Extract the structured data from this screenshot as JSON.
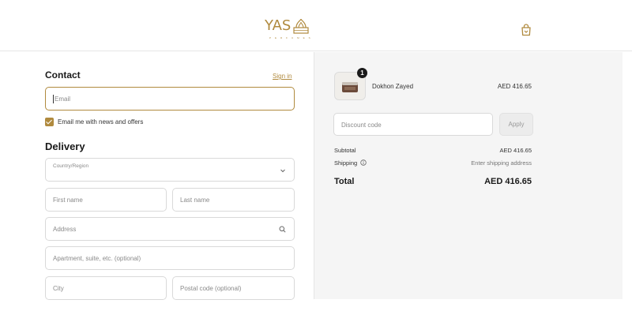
{
  "brand": {
    "logo_text": "YAS",
    "logo_sub": "PERFUMES",
    "accent": "#b08a3e"
  },
  "header": {
    "cart_icon": "shopping-bag-icon"
  },
  "contact": {
    "title": "Contact",
    "signin": "Sign in",
    "email_placeholder": "Email",
    "marketing_label": "Email me with news and offers",
    "marketing_checked": true
  },
  "delivery": {
    "title": "Delivery",
    "country_label": "Country/Region",
    "country_value": "",
    "first_name_placeholder": "First name",
    "last_name_placeholder": "Last name",
    "address_placeholder": "Address",
    "apartment_placeholder": "Apartment, suite, etc. (optional)",
    "city_placeholder": "City",
    "postal_placeholder": "Postal code (optional)"
  },
  "order": {
    "item": {
      "name": "Dokhon Zayed",
      "price": "AED 416.65",
      "quantity": "1"
    },
    "discount_placeholder": "Discount code",
    "apply_label": "Apply",
    "subtotal_label": "Subtotal",
    "subtotal_value": "AED 416.65",
    "shipping_label": "Shipping",
    "shipping_value": "Enter shipping address",
    "total_label": "Total",
    "total_value": "AED 416.65"
  }
}
